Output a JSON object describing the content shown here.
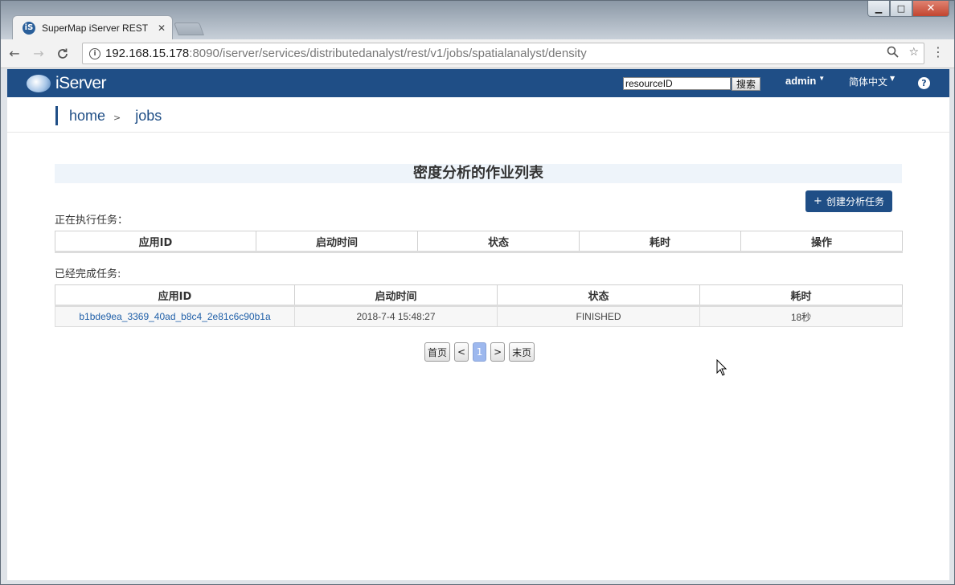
{
  "browser": {
    "tab_title": "SuperMap iServer REST",
    "tab_favicon": "iS",
    "url_host": "192.168.15.178",
    "url_rest": ":8090/iserver/services/distributedanalyst/rest/v1/jobs/spatialanalyst/density",
    "window_controls": {
      "min": "▁",
      "max": "□",
      "close": "✕"
    },
    "nav": {
      "back": "←",
      "forward": "→",
      "reload": "C"
    },
    "omni_icons": {
      "zoom": "⚲",
      "star": "☆"
    },
    "menu": "⋮"
  },
  "appbar": {
    "logo_text": "iServer",
    "search_value": "resourceID",
    "search_button": "搜索",
    "admin": "admin",
    "language": "简体中文",
    "help": "?"
  },
  "breadcrumb": {
    "home": "home",
    "sep": ">",
    "current": "jobs"
  },
  "main": {
    "title": "密度分析的作业列表",
    "create_button": "创建分析任务",
    "create_plus": "+",
    "running_label": "正在执行任务：",
    "running_columns": [
      "应用ID",
      "启动时间",
      "状态",
      "耗时",
      "操作"
    ],
    "finished_label": "已经完成任务:",
    "finished_columns": [
      "应用ID",
      "启动时间",
      "状态",
      "耗时"
    ],
    "finished_rows": [
      {
        "id": "b1bde9ea_3369_40ad_b8c4_2e81c6c90b1a",
        "start": "2018-7-4 15:48:27",
        "status": "FINISHED",
        "elapsed": "18秒"
      }
    ]
  },
  "pager": {
    "first": "首页",
    "prev": "<",
    "current": "1",
    "next": ">",
    "last": "末页"
  },
  "colors": {
    "appbar": "#1f4e86",
    "link": "#1f5fa8",
    "active_page": "#9db8ee"
  }
}
